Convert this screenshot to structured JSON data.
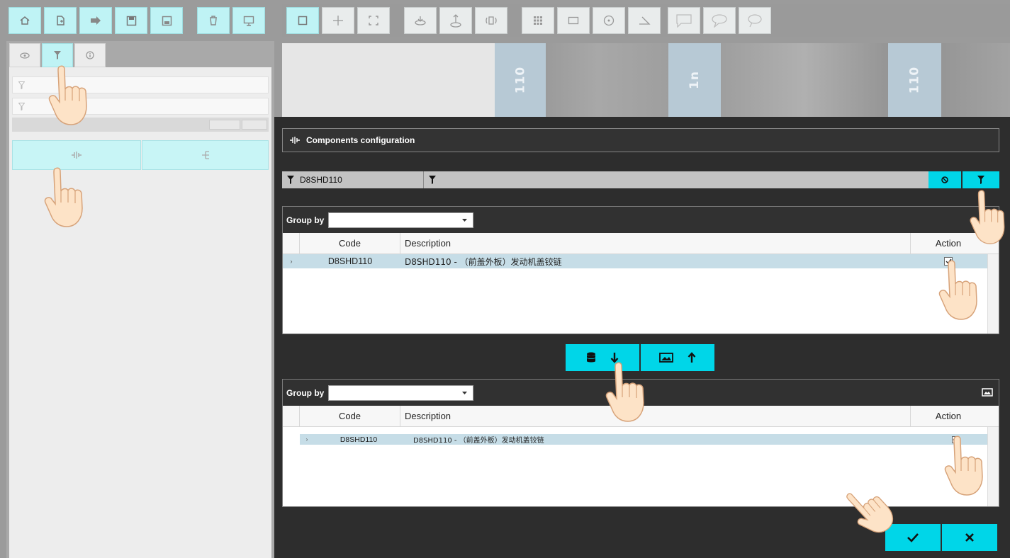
{
  "toolbar": {
    "left_group": [
      "home-icon",
      "new-file-icon",
      "export-arrow-icon",
      "save-icon",
      "save-as-icon",
      "trash-icon",
      "monitor-icon"
    ],
    "right_group": [
      "select-box-icon",
      "move-cross-icon",
      "fit-view-icon",
      "layer-down-icon",
      "layer-up-icon",
      "vibration-icon",
      "grid-icon",
      "rectangle-icon",
      "circle-icon",
      "angle-icon",
      "callout-square-icon",
      "callout-round-icon",
      "callout-thought-icon"
    ]
  },
  "viewport": {
    "machine_labels": [
      "110",
      "1n",
      "110"
    ]
  },
  "left_panel": {
    "tabs": [
      "eye-icon",
      "filter-icon",
      "info-icon"
    ],
    "action_buttons": [
      "components-icon",
      "tree-icon"
    ]
  },
  "dialog": {
    "title": "Components configuration",
    "filter": {
      "value": "D8SHD110"
    },
    "top_grid": {
      "group_by_label": "Group by",
      "group_by_value": "",
      "columns": [
        "Code",
        "Description",
        "Action"
      ],
      "rows": [
        {
          "code": "D8SHD110",
          "description": "D8SHD110 - （前盖外板）发动机盖铰链",
          "checked": true
        }
      ]
    },
    "bottom_grid": {
      "group_by_label": "Group by",
      "group_by_value": "",
      "columns": [
        "Code",
        "Description",
        "Action"
      ],
      "rows": [
        {
          "code": "D8SHD110",
          "description": "D8SHD110 - （前盖外板）发动机盖铰链",
          "checked": true
        }
      ]
    }
  },
  "colors": {
    "accent": "#00d6e8",
    "toolbar_bg": "#bff3f5",
    "dialog_bg": "#2d2d2d",
    "selected_row": "#c6dde7"
  }
}
